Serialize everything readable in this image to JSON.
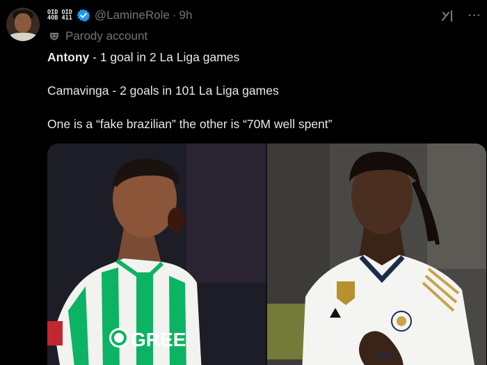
{
  "tweet": {
    "display_name_lines": [
      "OID OID",
      "4OB 411"
    ],
    "handle": "@LamineRole",
    "separator": "·",
    "time": "9h",
    "parody_label": "Parody account",
    "text": {
      "line1_bold": "Antony",
      "line1_rest": " - 1 goal in 2 La Liga games",
      "line2": "Camavinga - 2 goals in 101 La Liga games",
      "line3": "One is a “fake brazilian” the other is “70M well spent”"
    },
    "media": {
      "left_jersey_text": "GREE",
      "right_jersey_text": "tes"
    }
  },
  "colors": {
    "background": "#000000",
    "text_primary": "#e7e9ea",
    "text_secondary": "#71767b",
    "verified_blue": "#1d9bf0",
    "betis_green": "#0bb363",
    "real_white": "#f4f4f2",
    "gold": "#c9a24a"
  },
  "icons": [
    "verified-badge-icon",
    "parody-mask-icon",
    "grok-icon",
    "more-icon"
  ]
}
